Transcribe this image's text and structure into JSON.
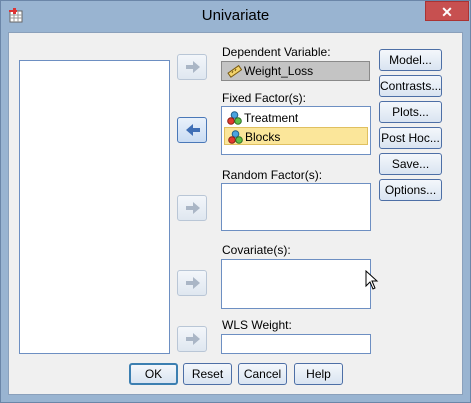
{
  "window": {
    "title": "Univariate",
    "close_glyph": "✕"
  },
  "labels": {
    "dependent": "Dependent Variable:",
    "fixed": "Fixed Factor(s):",
    "random": "Random Factor(s):",
    "covariate": "Covariate(s):",
    "wls": "WLS Weight:"
  },
  "dependent_variable": {
    "name": "Weight_Loss",
    "icon": "ruler-icon"
  },
  "fixed_factors": [
    {
      "name": "Treatment",
      "icon": "nominal-icon",
      "selected": false
    },
    {
      "name": "Blocks",
      "icon": "nominal-icon",
      "selected": true
    }
  ],
  "side_buttons": [
    "Model...",
    "Contrasts...",
    "Plots...",
    "Post Hoc...",
    "Save...",
    "Options..."
  ],
  "bottom_buttons": {
    "ok": "OK",
    "reset": "Reset",
    "cancel": "Cancel",
    "help": "Help"
  },
  "colors": {
    "titlebar": "#99b4d1",
    "selection": "#fbe69a",
    "close": "#c75050",
    "arrow": "#5a86c4"
  }
}
